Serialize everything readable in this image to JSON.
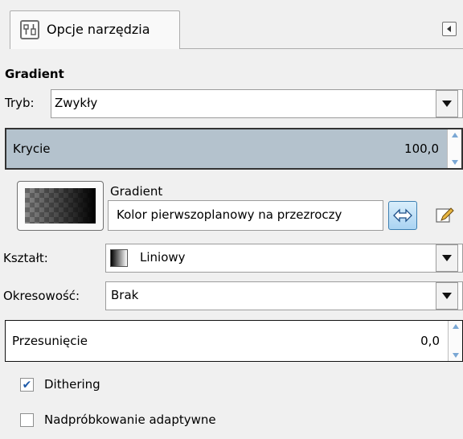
{
  "tab": {
    "label": "Opcje narzędzia"
  },
  "section_title": "Gradient",
  "mode": {
    "label": "Tryb:",
    "value": "Zwykły"
  },
  "opacity": {
    "label": "Krycie",
    "value": "100,0",
    "fill_percent": 100
  },
  "gradient": {
    "label": "Gradient",
    "value": "Kolor pierwszoplanowy na przezroczy"
  },
  "shape": {
    "label": "Kształt:",
    "value": "Liniowy"
  },
  "repeat": {
    "label": "Okresowość:",
    "value": "Brak"
  },
  "offset": {
    "label": "Przesunięcie",
    "value": "0,0",
    "fill_percent": 0
  },
  "dithering": {
    "label": "Dithering",
    "checked": true
  },
  "adaptive": {
    "label": "Nadpróbkowanie adaptywne",
    "checked": false
  },
  "colors": {
    "slider_fill": "#b4c2cd",
    "accent": "#3d7fd1"
  }
}
